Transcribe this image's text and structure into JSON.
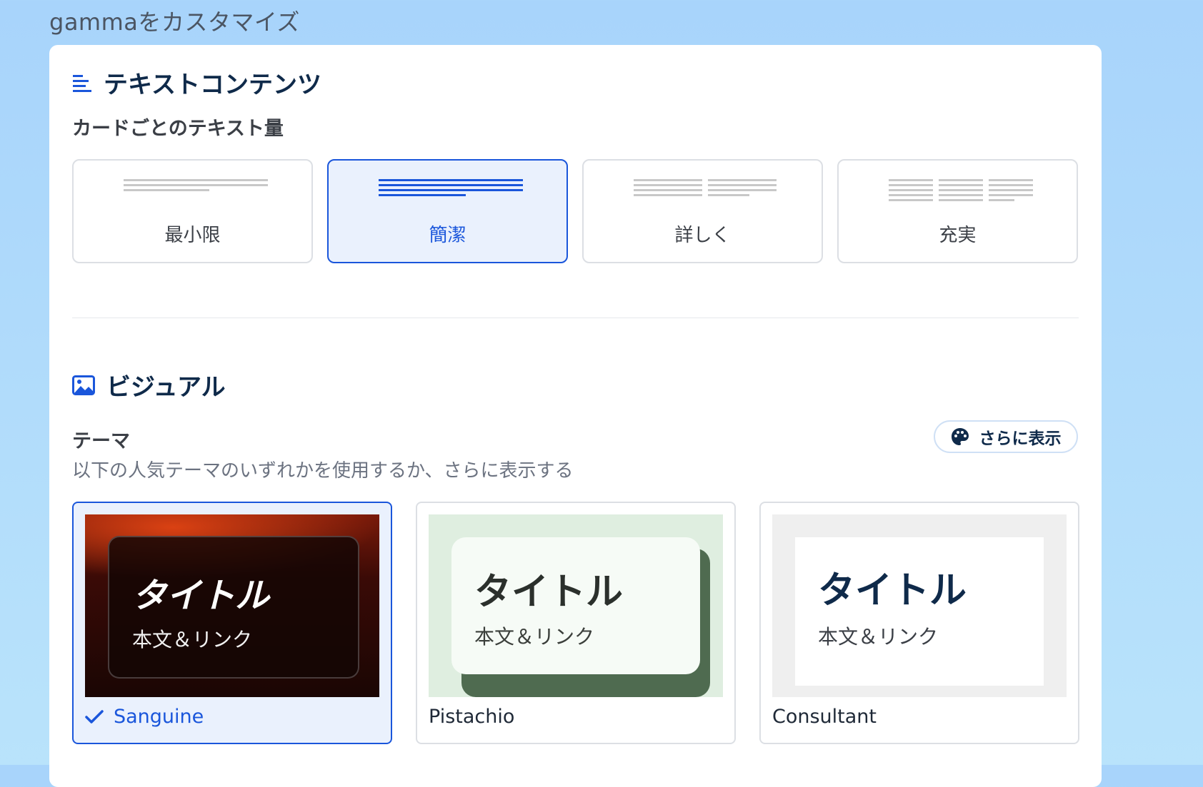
{
  "page_title": "gammaをカスタマイズ",
  "text_section": {
    "heading": "テキストコンテンツ",
    "label": "カードごとのテキスト量",
    "options": [
      {
        "label": "最小限",
        "selected": false
      },
      {
        "label": "簡潔",
        "selected": true
      },
      {
        "label": "詳しく",
        "selected": false
      },
      {
        "label": "充実",
        "selected": false
      }
    ]
  },
  "visual_section": {
    "heading": "ビジュアル",
    "theme_label": "テーマ",
    "theme_sub": "以下の人気テーマのいずれかを使用するか、さらに表示する",
    "more_button": "さらに表示",
    "themes": [
      {
        "name": "Sanguine",
        "selected": true,
        "preview_title": "タイトル",
        "preview_body": "本文＆リンク"
      },
      {
        "name": "Pistachio",
        "selected": false,
        "preview_title": "タイトル",
        "preview_body": "本文＆リンク"
      },
      {
        "name": "Consultant",
        "selected": false,
        "preview_title": "タイトル",
        "preview_body": "本文＆リンク"
      }
    ]
  },
  "colors": {
    "accent": "#1a56db",
    "heading": "#0f2a4a"
  }
}
